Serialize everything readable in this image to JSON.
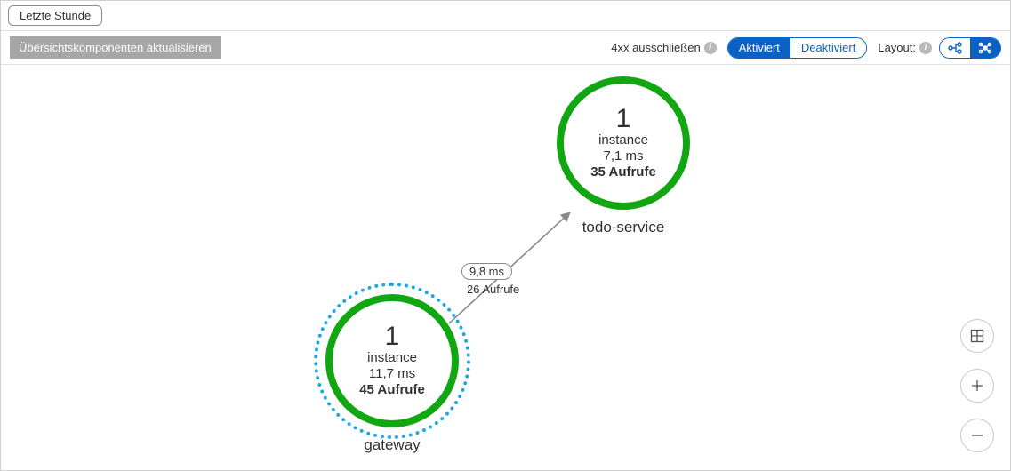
{
  "topbar": {
    "time_range": "Letzte Stunde"
  },
  "toolbar": {
    "refresh": "Übersichtskomponenten aktualisieren",
    "exclude4xx_label": "4xx ausschließen",
    "toggle_on": "Aktiviert",
    "toggle_off": "Deaktiviert",
    "layout_label": "Layout:"
  },
  "nodes": {
    "todo": {
      "count": "1",
      "instance": "instance",
      "latency": "7,1 ms",
      "calls": "35 Aufrufe",
      "name": "todo-service"
    },
    "gateway": {
      "count": "1",
      "instance": "instance",
      "latency": "11,7 ms",
      "calls": "45 Aufrufe",
      "name": "gateway"
    }
  },
  "edge": {
    "latency": "9,8 ms",
    "calls": "26 Aufrufe"
  }
}
